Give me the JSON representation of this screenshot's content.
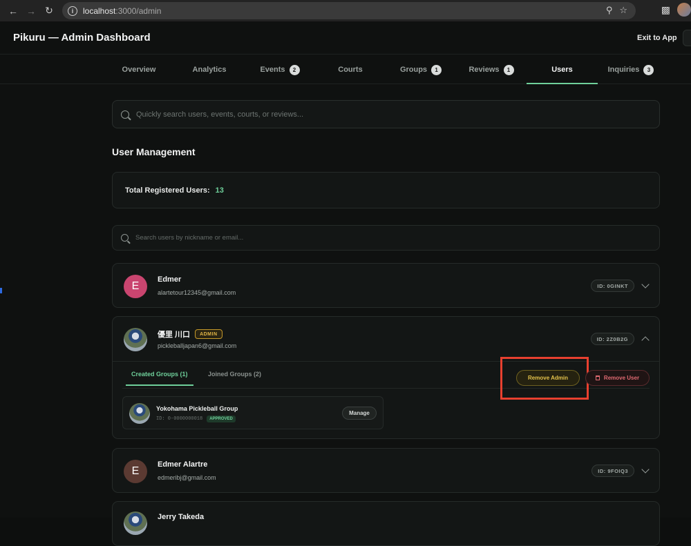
{
  "browser": {
    "url_host": "localhost",
    "url_path": ":3000/admin"
  },
  "header": {
    "title": "Pikuru — Admin Dashboard",
    "exit_label": "Exit to App"
  },
  "tabs": [
    {
      "label": "Overview",
      "badge": ""
    },
    {
      "label": "Analytics",
      "badge": ""
    },
    {
      "label": "Events",
      "badge": "2"
    },
    {
      "label": "Courts",
      "badge": ""
    },
    {
      "label": "Groups",
      "badge": "1"
    },
    {
      "label": "Reviews",
      "badge": "1"
    },
    {
      "label": "Users",
      "badge": "",
      "active": true
    },
    {
      "label": "Inquiries",
      "badge": "3"
    }
  ],
  "search": {
    "placeholder": "Quickly search users, events, courts, or reviews..."
  },
  "section": {
    "title": "User Management",
    "total_label": "Total Registered Users:",
    "total_value": "13",
    "user_search_placeholder": "Search users by nickname or email..."
  },
  "users": [
    {
      "initial": "E",
      "name": "Edmer",
      "email": "alartetour12345@gmail.com",
      "id": "ID: 0GINKT",
      "avatar_color": "#c9456f"
    },
    {
      "initial": "",
      "name": "優里 川口",
      "email": "pickleballjapan6@gmail.com",
      "id": "ID: 2Z0B2G",
      "admin_badge": "ADMIN"
    },
    {
      "initial": "E",
      "name": "Edmer Alartre",
      "email": "edmeribj@gmail.com",
      "id": "ID: 9FOIQ3",
      "avatar_color": "#5b3a32"
    },
    {
      "initial": "",
      "name": "Jerry Takeda",
      "email": "",
      "id": ""
    }
  ],
  "expanded": {
    "tab_created": "Created Groups (1)",
    "tab_joined": "Joined Groups (2)",
    "remove_admin": "Remove Admin",
    "remove_user": "Remove User",
    "group": {
      "name": "Yokohama Pickleball Group",
      "id": "ID: 0-0000000018",
      "status": "APPROVED",
      "manage": "Manage"
    }
  },
  "colors": {
    "accent": "#6fd09b",
    "admin": "#e3b747",
    "danger": "#e06a72",
    "highlight": "#e8402f"
  }
}
